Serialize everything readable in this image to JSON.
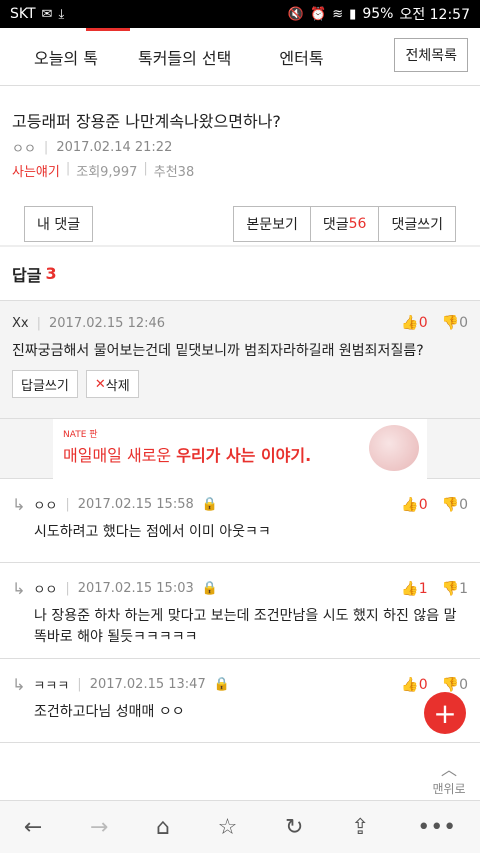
{
  "status": {
    "carrier": "SKT",
    "battery": "95%",
    "time": "오전 12:57"
  },
  "tabs": [
    "오늘의 톡",
    "톡커들의 선택",
    "엔터톡"
  ],
  "all_list": "전체목록",
  "post": {
    "title": "고등래퍼 장용준 나만계속나왔으면하나?",
    "author": "ㅇㅇ",
    "date": "2017.02.14 21:22",
    "category": "사는얘기",
    "views": "조회9,997",
    "recommends": "추천38"
  },
  "actions": {
    "my_comments": "내 댓글",
    "view_post": "본문보기",
    "comments_label": "댓글",
    "comments_count": "56",
    "write_comment": "댓글쓰기"
  },
  "reply_header": {
    "label": "답글",
    "count": "3"
  },
  "comment": {
    "author": "Xx",
    "date": "2017.02.15 12:46",
    "up": "0",
    "down": "0",
    "text": "진짜궁금해서 물어보는건데 밑댓보니까 범죄자라하길래 원범죄저질름?",
    "reply_btn": "답글쓰기",
    "delete_btn": "삭제"
  },
  "ad": {
    "brand": "NATE 판",
    "text_a": "매일매일 새로운 ",
    "text_b": "우리가 사는 이야기."
  },
  "replies": [
    {
      "author": "ㅇㅇ",
      "date": "2017.02.15 15:58",
      "up": "0",
      "down": "0",
      "text": "시도하려고 했다는 점에서 이미 아웃ㅋㅋ"
    },
    {
      "author": "ㅇㅇ",
      "date": "2017.02.15 15:03",
      "up": "1",
      "down": "1",
      "text": "나 장용준 하차 하는게 맞다고 보는데 조건만남을 시도 했지 하진 않음 말 똑바로 해야 될듯ㅋㅋㅋㅋㅋ"
    },
    {
      "author": "ㅋㅋㅋ",
      "date": "2017.02.15 13:47",
      "up": "0",
      "down": "0",
      "text": "조건하고다님 성매매 ㅇㅇ"
    }
  ],
  "to_top": "맨위로",
  "colors": {
    "accent": "#e8312d"
  }
}
